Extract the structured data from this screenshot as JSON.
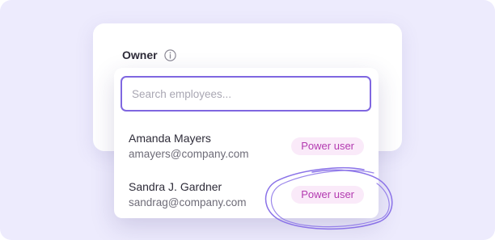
{
  "owner_field": {
    "label": "Owner",
    "info_icon": "info-circle-icon"
  },
  "search": {
    "placeholder": "Search employees...",
    "value": ""
  },
  "employees": [
    {
      "name": "Amanda Mayers",
      "email": "amayers@company.com",
      "badge": "Power user"
    },
    {
      "name": "Sandra J. Gardner",
      "email": "sandrag@company.com",
      "badge": "Power user"
    }
  ],
  "colors": {
    "background": "#edebfd",
    "accent": "#7f67e0",
    "badge_bg": "#faeaf9",
    "badge_text": "#b33ab0"
  }
}
